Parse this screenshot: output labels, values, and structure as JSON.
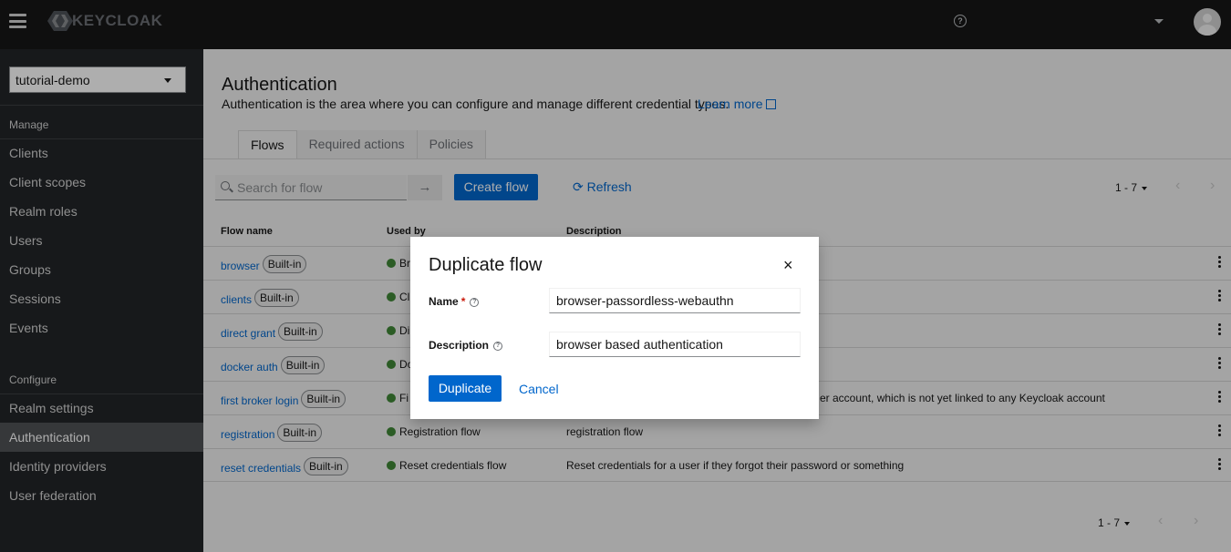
{
  "app": {
    "logo_text": "KEYCLOAK"
  },
  "sidebar": {
    "realm": "tutorial-demo",
    "manage_heading": "Manage",
    "manage_items": [
      "Clients",
      "Client scopes",
      "Realm roles",
      "Users",
      "Groups",
      "Sessions",
      "Events"
    ],
    "configure_heading": "Configure",
    "configure_items": [
      "Realm settings",
      "Authentication",
      "Identity providers",
      "User federation"
    ],
    "active": "Authentication"
  },
  "page": {
    "title": "Authentication",
    "description": "Authentication is the area where you can configure and manage different credential types.",
    "learn_more": "Learn more"
  },
  "tabs": [
    "Flows",
    "Required actions",
    "Policies"
  ],
  "toolbar": {
    "search_placeholder": "Search for flow",
    "create_label": "Create flow",
    "refresh_label": "Refresh",
    "pagination": "1 - 7"
  },
  "table": {
    "headers": [
      "Flow name",
      "Used by",
      "Description"
    ],
    "rows": [
      {
        "name": "browser",
        "badge": "Built-in",
        "used": "Br",
        "desc": ""
      },
      {
        "name": "clients",
        "badge": "Built-in",
        "used": "Cl",
        "desc": ""
      },
      {
        "name": "direct grant",
        "badge": "Built-in",
        "used": "Di",
        "desc": ""
      },
      {
        "name": "docker auth",
        "badge": "Built-in",
        "used": "Do",
        "desc": ""
      },
      {
        "name": "first broker login",
        "badge": "Built-in",
        "used": "Fi",
        "desc": "er account, which is not yet linked to any Keycloak account"
      },
      {
        "name": "registration",
        "badge": "Built-in",
        "used": "Registration flow",
        "desc": "registration flow"
      },
      {
        "name": "reset credentials",
        "badge": "Built-in",
        "used": "Reset credentials flow",
        "desc": "Reset credentials for a user if they forgot their password or something"
      }
    ]
  },
  "footer": {
    "pagination": "1 - 7"
  },
  "modal": {
    "title": "Duplicate flow",
    "name_label": "Name",
    "name_value": "browser-passordless-webauthn",
    "description_label": "Description",
    "description_value": "browser based authentication",
    "duplicate_label": "Duplicate",
    "cancel_label": "Cancel"
  },
  "colors": {
    "header": "#151515",
    "sidebar": "#212427",
    "accent": "#0066cc",
    "success": "#3e8635"
  }
}
